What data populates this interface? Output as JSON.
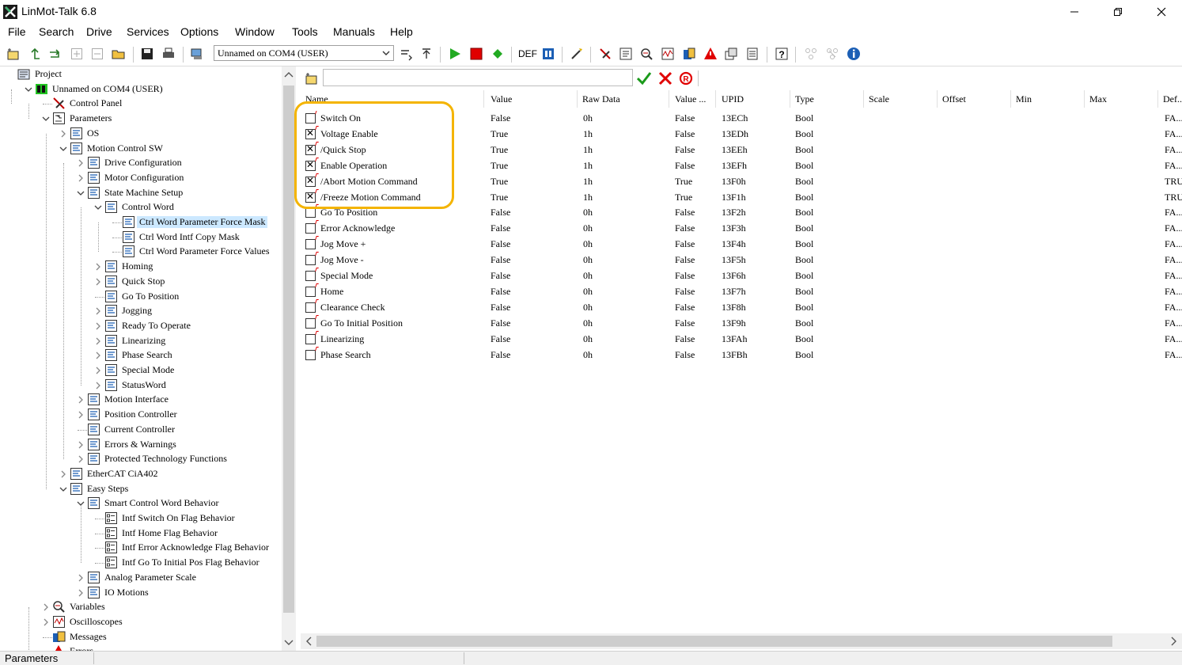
{
  "window": {
    "title": "LinMot-Talk 6.8"
  },
  "menu": [
    "File",
    "Search",
    "Drive",
    "Services",
    "Options",
    "Window",
    "Tools",
    "Manuals",
    "Help"
  ],
  "toolbar": {
    "connection_combo": "Unnamed on COM4 (USER)",
    "def_label": "DEF"
  },
  "tree": {
    "nodes": [
      {
        "label": "Project",
        "icon": "project-icon"
      },
      {
        "label": "Unnamed on COM4 (USER)",
        "icon": "drive-icon"
      },
      {
        "label": "Control Panel",
        "icon": "control-panel-icon"
      },
      {
        "label": "Parameters",
        "icon": "parameters-icon"
      },
      {
        "label": "OS",
        "icon": "folder-icon"
      },
      {
        "label": "Motion Control SW",
        "icon": "folder-icon"
      },
      {
        "label": "Drive Configuration",
        "icon": "folder-icon"
      },
      {
        "label": "Motor Configuration",
        "icon": "folder-icon"
      },
      {
        "label": "State Machine Setup",
        "icon": "folder-icon"
      },
      {
        "label": "Control Word",
        "icon": "folder-icon"
      },
      {
        "label": "Ctrl Word Parameter Force Mask",
        "icon": "param-icon",
        "selected": true
      },
      {
        "label": "Ctrl Word Intf Copy Mask",
        "icon": "param-icon"
      },
      {
        "label": "Ctrl Word Parameter Force Values",
        "icon": "param-icon"
      },
      {
        "label": "Homing",
        "icon": "folder-icon"
      },
      {
        "label": "Quick Stop",
        "icon": "folder-icon"
      },
      {
        "label": "Go To Position",
        "icon": "folder-icon"
      },
      {
        "label": "Jogging",
        "icon": "folder-icon"
      },
      {
        "label": "Ready To Operate",
        "icon": "folder-icon"
      },
      {
        "label": "Linearizing",
        "icon": "folder-icon"
      },
      {
        "label": "Phase Search",
        "icon": "folder-icon"
      },
      {
        "label": "Special Mode",
        "icon": "folder-icon"
      },
      {
        "label": "StatusWord",
        "icon": "folder-icon"
      },
      {
        "label": "Motion Interface",
        "icon": "folder-icon"
      },
      {
        "label": "Position Controller",
        "icon": "folder-icon"
      },
      {
        "label": "Current Controller",
        "icon": "folder-icon"
      },
      {
        "label": "Errors & Warnings",
        "icon": "folder-icon"
      },
      {
        "label": "Protected Technology Functions",
        "icon": "folder-icon"
      },
      {
        "label": "EtherCAT CiA402",
        "icon": "folder-icon"
      },
      {
        "label": "Easy Steps",
        "icon": "folder-icon"
      },
      {
        "label": "Smart Control Word Behavior",
        "icon": "folder-icon"
      },
      {
        "label": "Intf Switch On Flag Behavior",
        "icon": "list-param-icon"
      },
      {
        "label": "Intf Home Flag Behavior",
        "icon": "list-param-icon"
      },
      {
        "label": "Intf Error Acknowledge Flag Behavior",
        "icon": "list-param-icon"
      },
      {
        "label": "Intf Go To Initial Pos Flag Behavior",
        "icon": "list-param-icon"
      },
      {
        "label": "Analog Parameter Scale",
        "icon": "folder-icon"
      },
      {
        "label": "IO Motions",
        "icon": "folder-icon"
      },
      {
        "label": "Variables",
        "icon": "variables-icon"
      },
      {
        "label": "Oscilloscopes",
        "icon": "oscilloscope-icon"
      },
      {
        "label": "Messages",
        "icon": "messages-icon"
      },
      {
        "label": "Errors",
        "icon": "errors-icon"
      }
    ]
  },
  "grid": {
    "columns": [
      "Name",
      "Value",
      "Raw Data",
      "Value ...",
      "UPID",
      "Type",
      "Scale",
      "Offset",
      "Min",
      "Max",
      "Def..."
    ],
    "rows": [
      {
        "checked": false,
        "name": "Switch On",
        "value": "False",
        "raw": "0h",
        "value2": "False",
        "upid": "13ECh",
        "type": "Bool",
        "def": "FA..."
      },
      {
        "checked": true,
        "name": "Voltage Enable",
        "value": "True",
        "raw": "1h",
        "value2": "False",
        "upid": "13EDh",
        "type": "Bool",
        "def": "FA..."
      },
      {
        "checked": true,
        "name": "/Quick Stop",
        "value": "True",
        "raw": "1h",
        "value2": "False",
        "upid": "13EEh",
        "type": "Bool",
        "def": "FA..."
      },
      {
        "checked": true,
        "name": "Enable Operation",
        "value": "True",
        "raw": "1h",
        "value2": "False",
        "upid": "13EFh",
        "type": "Bool",
        "def": "FA..."
      },
      {
        "checked": true,
        "name": "/Abort Motion Command",
        "value": "True",
        "raw": "1h",
        "value2": "True",
        "upid": "13F0h",
        "type": "Bool",
        "def": "TRU"
      },
      {
        "checked": true,
        "name": "/Freeze Motion Command",
        "value": "True",
        "raw": "1h",
        "value2": "True",
        "upid": "13F1h",
        "type": "Bool",
        "def": "TRU"
      },
      {
        "checked": false,
        "name": "Go To Position",
        "value": "False",
        "raw": "0h",
        "value2": "False",
        "upid": "13F2h",
        "type": "Bool",
        "def": "FA..."
      },
      {
        "checked": false,
        "name": "Error Acknowledge",
        "value": "False",
        "raw": "0h",
        "value2": "False",
        "upid": "13F3h",
        "type": "Bool",
        "def": "FA..."
      },
      {
        "checked": false,
        "name": "Jog Move +",
        "value": "False",
        "raw": "0h",
        "value2": "False",
        "upid": "13F4h",
        "type": "Bool",
        "def": "FA..."
      },
      {
        "checked": false,
        "name": "Jog Move -",
        "value": "False",
        "raw": "0h",
        "value2": "False",
        "upid": "13F5h",
        "type": "Bool",
        "def": "FA..."
      },
      {
        "checked": false,
        "name": "Special Mode",
        "value": "False",
        "raw": "0h",
        "value2": "False",
        "upid": "13F6h",
        "type": "Bool",
        "def": "FA..."
      },
      {
        "checked": false,
        "name": "Home",
        "value": "False",
        "raw": "0h",
        "value2": "False",
        "upid": "13F7h",
        "type": "Bool",
        "def": "FA..."
      },
      {
        "checked": false,
        "name": "Clearance Check",
        "value": "False",
        "raw": "0h",
        "value2": "False",
        "upid": "13F8h",
        "type": "Bool",
        "def": "FA..."
      },
      {
        "checked": false,
        "name": "Go To Initial Position",
        "value": "False",
        "raw": "0h",
        "value2": "False",
        "upid": "13F9h",
        "type": "Bool",
        "def": "FA..."
      },
      {
        "checked": false,
        "name": "Linearizing",
        "value": "False",
        "raw": "0h",
        "value2": "False",
        "upid": "13FAh",
        "type": "Bool",
        "def": "FA..."
      },
      {
        "checked": false,
        "name": "Phase Search",
        "value": "False",
        "raw": "0h",
        "value2": "False",
        "upid": "13FBh",
        "type": "Bool",
        "def": "FA..."
      }
    ]
  },
  "status": {
    "text": "Parameters"
  },
  "colors": {
    "highlight": "#f4b400",
    "selection": "#cce8ff",
    "run": "#22aa22",
    "stop": "#e00000"
  }
}
